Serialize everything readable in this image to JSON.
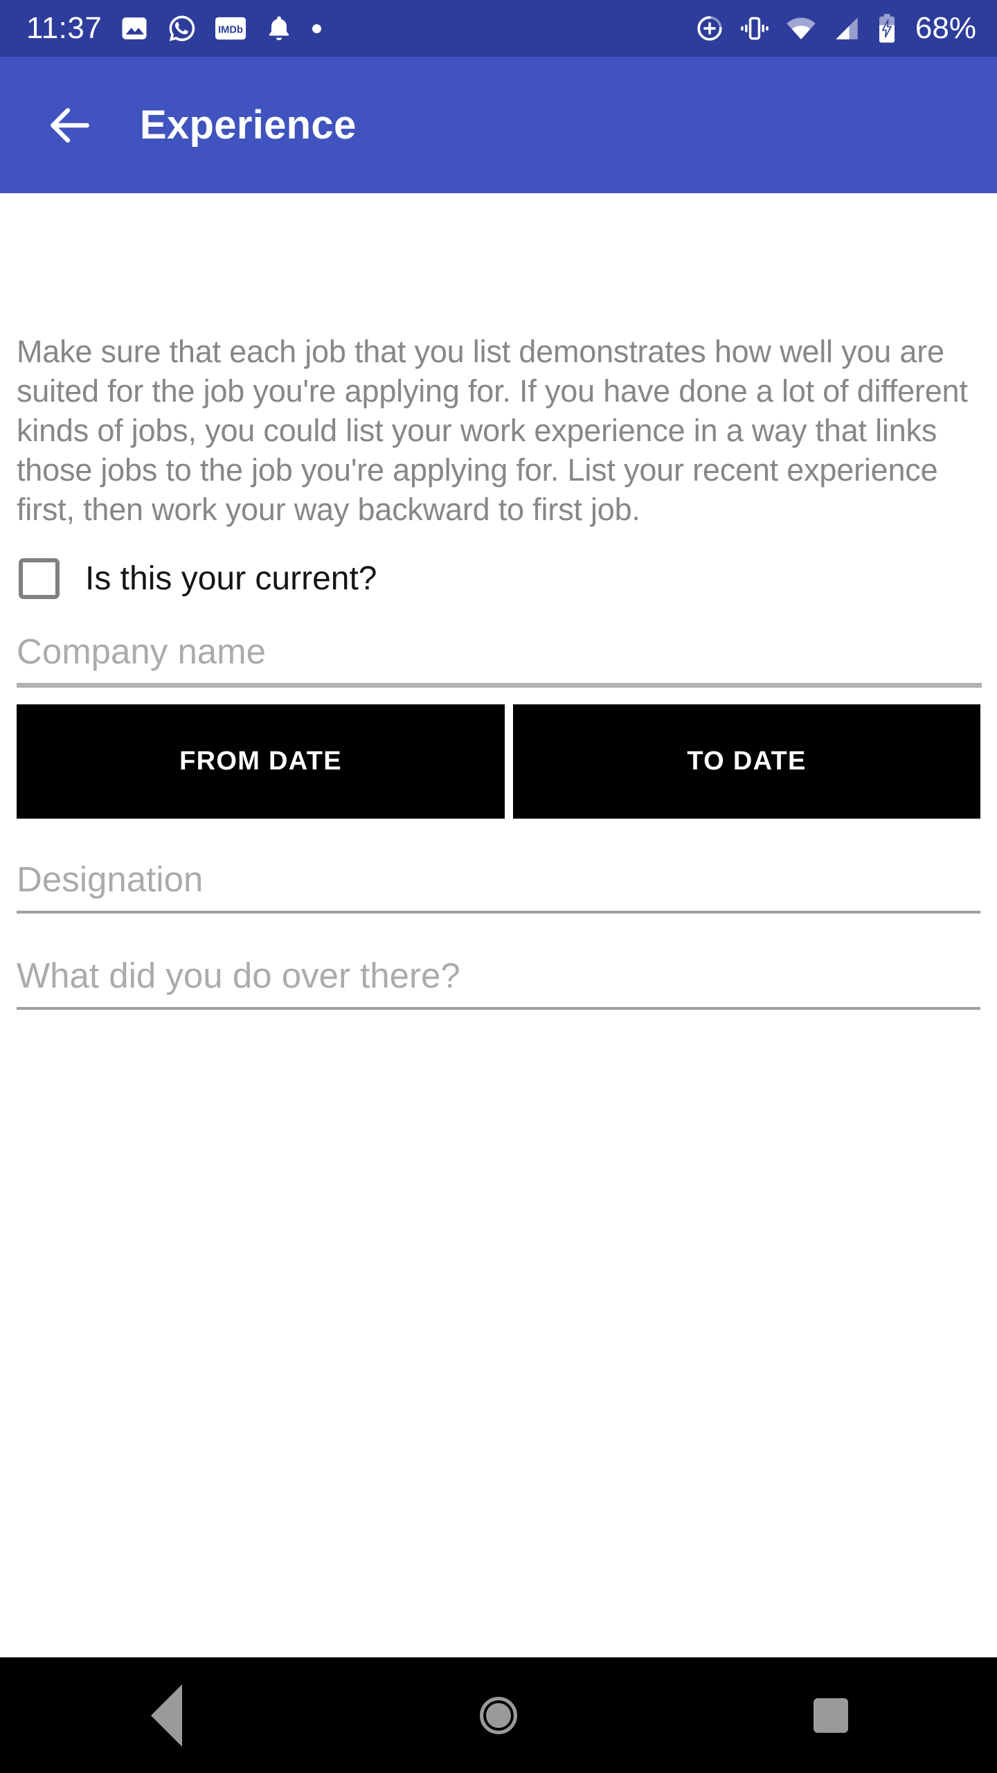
{
  "status_bar": {
    "time": "11:37",
    "battery_percent": "68%",
    "left_icons": [
      "gallery-icon",
      "whatsapp-icon",
      "imdb-icon",
      "bell-icon",
      "dot-icon"
    ],
    "right_icons": [
      "data-saver-icon",
      "vibrate-icon",
      "wifi-icon",
      "cellular-signal-icon",
      "battery-charging-icon"
    ],
    "background_color": "#2E3D9B"
  },
  "app_bar": {
    "title": "Experience",
    "back_icon": "arrow-left-icon",
    "background_color": "#4053BE",
    "text_color": "#FFFFFF"
  },
  "content": {
    "intro_text": "Make sure that each job that you list demonstrates how well you are suited for the job you're applying for. If you have done a lot of different kinds of jobs, you could list your work experience in a way that links those jobs to the job you're applying for. List your recent experience first, then work your way backward to first job.",
    "current_checkbox": {
      "label": "Is this your current?",
      "checked": false
    },
    "fields": {
      "company": {
        "placeholder": "Company name",
        "value": ""
      },
      "designation": {
        "placeholder": "Designation",
        "value": ""
      },
      "description": {
        "placeholder": "What did you do over there?",
        "value": ""
      }
    },
    "date_buttons": {
      "from_label": "FROM DATE",
      "to_label": "TO DATE",
      "background_color": "#000000",
      "text_color": "#FFFFFF"
    },
    "placeholder_color": "#ABABAB",
    "intro_text_color": "#878787"
  },
  "nav_bar": {
    "background_color": "#000000",
    "icon_color": "#9A9A9A",
    "buttons": [
      "back-nav-icon",
      "home-nav-icon",
      "recents-nav-icon"
    ]
  }
}
